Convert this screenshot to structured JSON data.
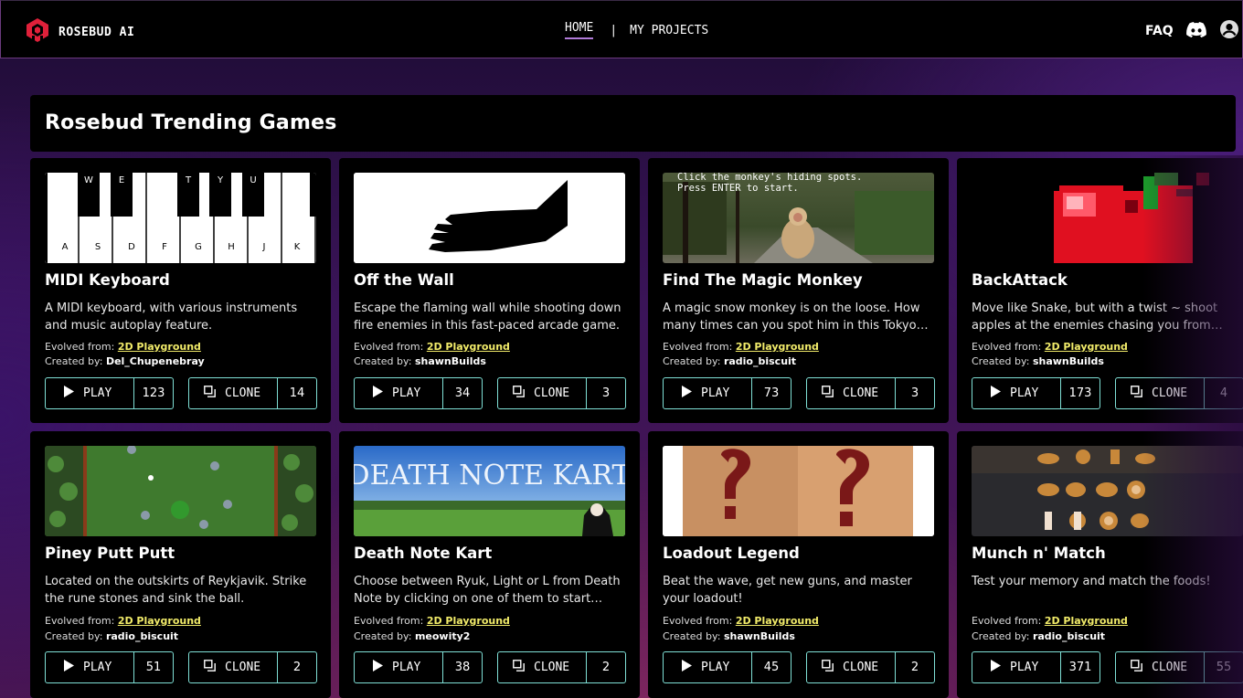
{
  "header": {
    "brand": "ROSEBUD AI",
    "nav": {
      "home": "HOME",
      "separator": "|",
      "projects": "MY PROJECTS"
    },
    "faq": "FAQ",
    "icons": [
      "rosebud-logo-icon",
      "discord-icon",
      "user-avatar-icon"
    ],
    "colors": {
      "accent": "#b07ad8",
      "brand_red": "#e0203a"
    }
  },
  "section": {
    "title": "Rosebud Trending Games"
  },
  "labels": {
    "evolved_from": "Evolved from:",
    "created_by": "Created by:",
    "play": "PLAY",
    "clone": "CLONE"
  },
  "games": [
    {
      "title": "MIDI Keyboard",
      "description": "A MIDI keyboard, with various instruments and music autoplay feature.",
      "evolved_from": "2D Playground",
      "creator": "Del_Chupenebray",
      "plays": "123",
      "clones": "14",
      "thumb": {
        "black_keys": [
          "W",
          "E",
          "T",
          "Y",
          "U"
        ],
        "white_keys": [
          "A",
          "S",
          "D",
          "F",
          "G",
          "H",
          "J",
          "K"
        ]
      }
    },
    {
      "title": "Off the Wall",
      "description": "Escape the flaming wall while shooting down fire enemies in this fast-paced arcade game.",
      "evolved_from": "2D Playground",
      "creator": "shawnBuilds",
      "plays": "34",
      "clones": "3"
    },
    {
      "title": "Find The Magic Monkey",
      "description": "A magic snow monkey is on the loose. How many times can you spot him in this Tokyo park?",
      "evolved_from": "2D Playground",
      "creator": "radio_biscuit",
      "plays": "73",
      "clones": "3",
      "thumb": {
        "line1": "Click the monkey's hiding spots.",
        "line2": "Press ENTER to start."
      }
    },
    {
      "title": "BackAttack",
      "description": "Move like Snake, but with a twist ~ shoot apples at the enemies chasing you from behind!",
      "evolved_from": "2D Playground",
      "creator": "shawnBuilds",
      "plays": "173",
      "clones": "4"
    },
    {
      "title": "Piney Putt Putt",
      "description": "Located on the outskirts of Reykjavik. Strike the rune stones and sink the ball.",
      "evolved_from": "2D Playground",
      "creator": "radio_biscuit",
      "plays": "51",
      "clones": "2"
    },
    {
      "title": "Death Note Kart",
      "description": "Choose between Ryuk, Light or L from Death Note by clicking on one of them to start racing.",
      "evolved_from": "2D Playground",
      "creator": "meowity2",
      "plays": "38",
      "clones": "2",
      "thumb": {
        "text": "DEATH NOTE KART"
      }
    },
    {
      "title": "Loadout Legend",
      "description": "Beat the wave, get new guns, and master your loadout!",
      "evolved_from": "2D Playground",
      "creator": "shawnBuilds",
      "plays": "45",
      "clones": "2"
    },
    {
      "title": "Munch n' Match",
      "description": "Test your memory and match the foods!",
      "evolved_from": "2D Playground",
      "creator": "radio_biscuit",
      "plays": "371",
      "clones": "55"
    }
  ]
}
